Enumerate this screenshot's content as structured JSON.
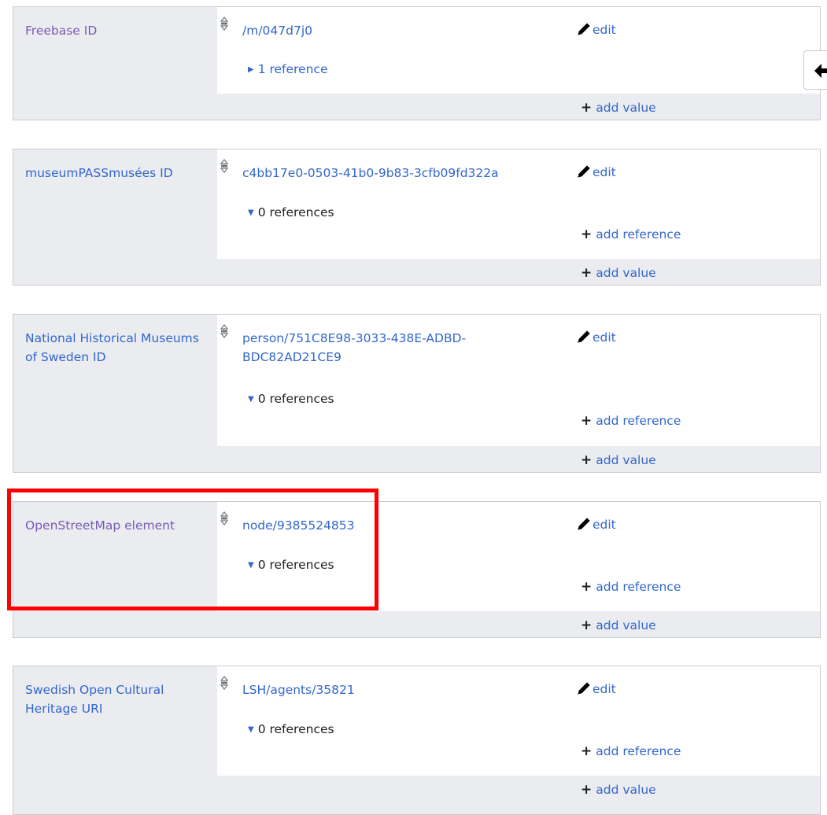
{
  "statements": [
    {
      "property": "Freebase ID",
      "value": "/m/047d7j0",
      "edit_label": "edit",
      "references_label": "1 reference",
      "references_expanded": false,
      "add_value_label": "add value"
    },
    {
      "property": "museumPASSmusées ID",
      "value": "c4bb17e0-0503-41b0-9b83-3cfb09fd322a",
      "edit_label": "edit",
      "references_label": "0 references",
      "references_expanded": true,
      "add_reference_label": "add reference",
      "add_value_label": "add value"
    },
    {
      "property_line1": "National Historical Museums",
      "property_line2": "of Sweden ID",
      "value_line1": "person/751C8E98-3033-438E-ADBD-",
      "value_line2": "BDC82AD21CE9",
      "edit_label": "edit",
      "references_label": "0 references",
      "references_expanded": true,
      "add_reference_label": "add reference",
      "add_value_label": "add value"
    },
    {
      "property": "OpenStreetMap element",
      "value": "node/9385524853",
      "edit_label": "edit",
      "references_label": "0 references",
      "references_expanded": true,
      "add_reference_label": "add reference",
      "add_value_label": "add value",
      "highlighted": true
    },
    {
      "property_line1": "Swedish Open Cultural",
      "property_line2": "Heritage URI",
      "value": "LSH/agents/35821",
      "edit_label": "edit",
      "references_label": "0 references",
      "references_expanded": true,
      "add_reference_label": "add reference",
      "add_value_label": "add value"
    }
  ],
  "icons": {
    "rank": "rank-normal-icon",
    "edit": "pencil-icon",
    "add": "plus-icon",
    "collapsed": "triangle-right-icon",
    "expanded": "triangle-down-icon",
    "side_tab": "arrow-left-icon"
  },
  "colors": {
    "link": "#3366cc",
    "visited_link": "#795cb2",
    "block_bg": "#eaecf0",
    "border": "#c8ccd1",
    "highlight": "#ff0000"
  }
}
